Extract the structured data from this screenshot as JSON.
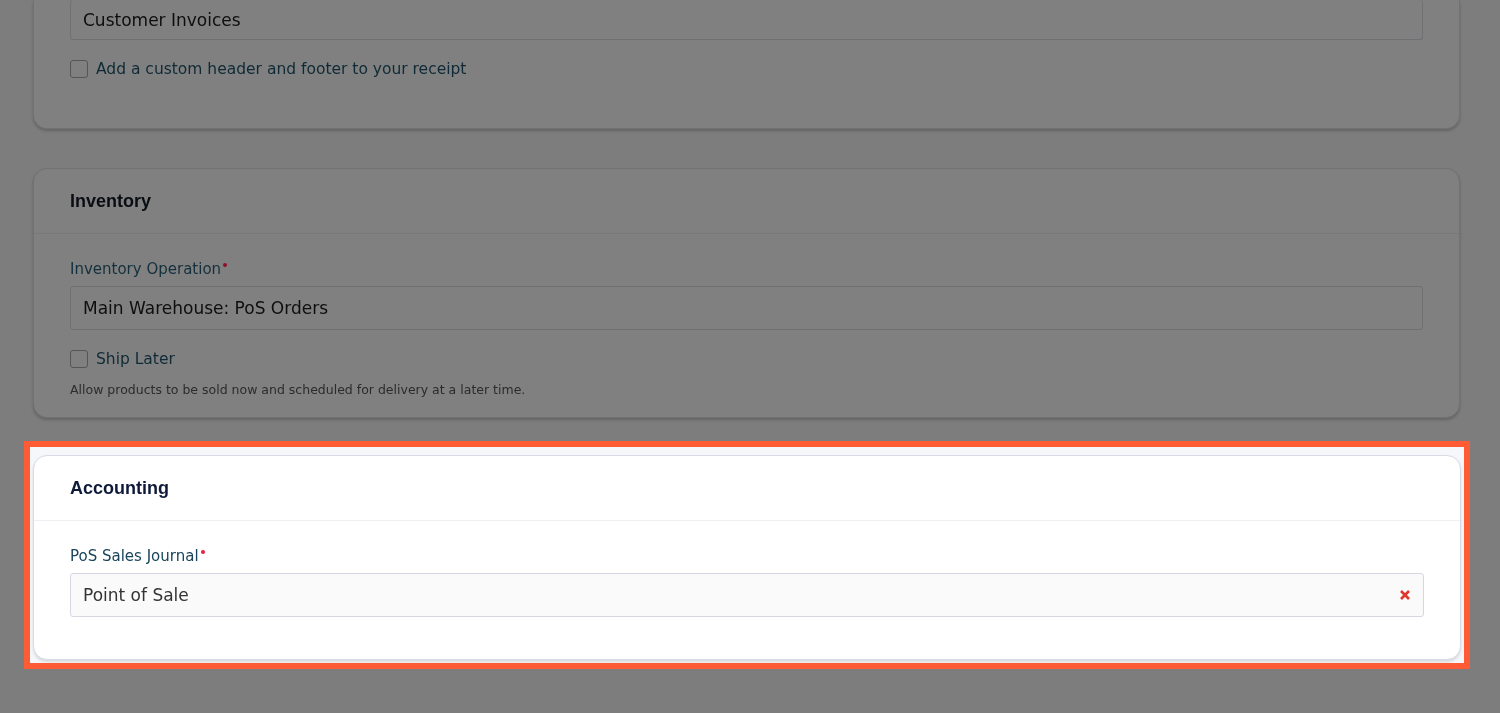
{
  "sections": [
    {
      "highlighted": false,
      "dimmed": true,
      "field": {
        "value": "Customer Invoices"
      },
      "checkbox": {
        "label": "Add a custom header and footer to your receipt",
        "checked": false
      }
    },
    {
      "title": "Inventory",
      "highlighted": false,
      "dimmed": true,
      "field": {
        "label": "Inventory Operation",
        "required": true,
        "value": "Main Warehouse: PoS Orders"
      },
      "checkbox": {
        "label": "Ship Later",
        "checked": false,
        "help": "Allow products to be sold now and scheduled for delivery at a later time."
      }
    },
    {
      "title": "Accounting",
      "highlighted": true,
      "dimmed": false,
      "field": {
        "label": "PoS Sales Journal",
        "required": true,
        "value": "Point of Sale",
        "clearable": true
      }
    }
  ]
}
